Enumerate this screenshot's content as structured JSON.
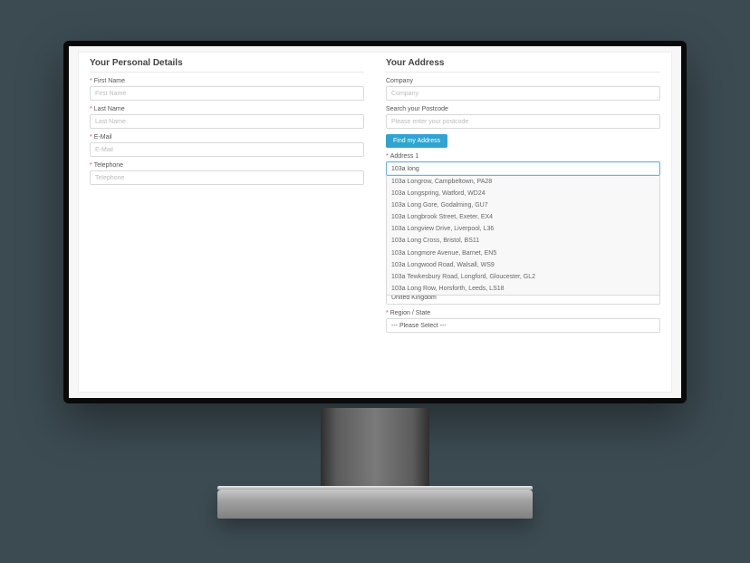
{
  "personal": {
    "heading": "Your Personal Details",
    "first_name": {
      "label": "First Name",
      "placeholder": "First Name",
      "value": ""
    },
    "last_name": {
      "label": "Last Name",
      "placeholder": "Last Name",
      "value": ""
    },
    "email": {
      "label": "E-Mail",
      "placeholder": "E-Mail",
      "value": ""
    },
    "telephone": {
      "label": "Telephone",
      "placeholder": "Telephone",
      "value": ""
    }
  },
  "address": {
    "heading": "Your Address",
    "company": {
      "label": "Company",
      "placeholder": "Company",
      "value": ""
    },
    "postcode": {
      "label": "Search your Postcode",
      "placeholder": "Please enter your postcode",
      "value": ""
    },
    "find_button": "Find my Address",
    "address1": {
      "label": "Address 1",
      "value": "103a long"
    },
    "suggestions": [
      "103a Longrow, Campbeltown, PA28",
      "103a Longspring, Watford, WD24",
      "103a Long Gore, Godalming, GU7",
      "103a Longbrook Street, Exeter, EX4",
      "103a Longview Drive, Liverpool, L36",
      "103a Long Cross, Bristol, BS11",
      "103a Longmore Avenue, Barnet, EN5",
      "103a Longwood Road, Walsall, WS9",
      "103a Tewkesbury Road, Longford, Gloucester, GL2",
      "103a Long Row, Horsforth, Leeds, LS18"
    ],
    "country": {
      "value": "United Kingdom"
    },
    "region": {
      "label": "Region / State",
      "value": "--- Please Select ---"
    }
  }
}
